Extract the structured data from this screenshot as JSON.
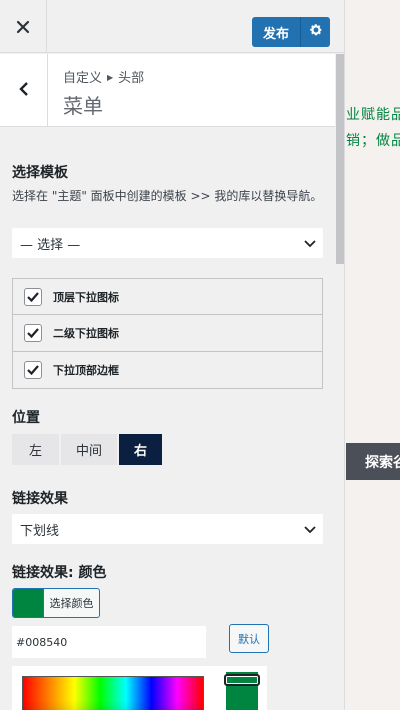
{
  "header": {
    "close_icon": "close-icon",
    "publish_label": "发布",
    "settings_icon": "gear-icon"
  },
  "section": {
    "back_icon": "chevron-left-icon",
    "breadcrumb_parent": "自定义",
    "breadcrumb_child": "头部",
    "title": "菜单"
  },
  "template": {
    "label": "选择模板",
    "description": "选择在 \"主题\" 面板中创建的模板 >> 我的库以替换导航。",
    "select_value": "— 选择 —"
  },
  "checkboxes": [
    {
      "label": "顶层下拉图标",
      "checked": true
    },
    {
      "label": "二级下拉图标",
      "checked": true
    },
    {
      "label": "下拉顶部边框",
      "checked": true
    }
  ],
  "position": {
    "label": "位置",
    "options": [
      "左",
      "中间",
      "右"
    ],
    "selected": "右"
  },
  "link_effect": {
    "label": "链接效果",
    "select_value": "下划线"
  },
  "link_color": {
    "label": "链接效果: 颜色",
    "button_label": "选择颜色",
    "hex_value": "#008540",
    "default_label": "默认",
    "swatch_color": "#008540"
  },
  "preview": {
    "line1": "业赋能品",
    "line2": "销；做品",
    "button_label": "探索谷"
  },
  "colors": {
    "accent": "#2271b1",
    "selected_segment": "#0b2041",
    "brand_green": "#008540"
  }
}
